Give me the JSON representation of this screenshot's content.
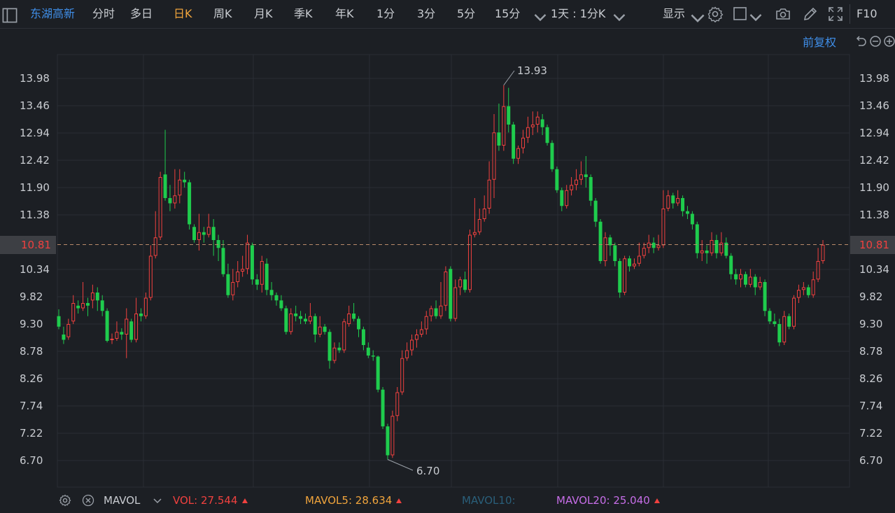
{
  "toolbar": {
    "stock_name": "东湖高新",
    "periods": [
      "分时",
      "多日",
      "日K",
      "周K",
      "月K",
      "季K",
      "年K",
      "1分",
      "3分",
      "5分",
      "15分"
    ],
    "active_period": "日K",
    "more_periods_icon": "chevron-down-icon",
    "interval_label": "1天 : 1分K",
    "display_label": "显示",
    "icons": [
      "settings-icon",
      "square-icon",
      "camera-icon",
      "pen-icon",
      "fullscreen-icon"
    ],
    "f10_label": "F10"
  },
  "price_panel": {
    "adjust_label": "前复权",
    "current_price_label": "10.81",
    "high_label": "13.93",
    "low_label": "6.70",
    "colors": {
      "up": "#f0413f",
      "down": "#1fcc4d",
      "grid": "#2a2e35",
      "background": "#1c1f24"
    }
  },
  "chart_data": {
    "type": "candlestick",
    "y_ticks": [
      "13.98",
      "13.46",
      "12.94",
      "12.42",
      "11.90",
      "11.38",
      "10.81",
      "10.34",
      "9.82",
      "9.30",
      "8.78",
      "8.26",
      "7.74",
      "7.22",
      "6.70"
    ],
    "ylim": [
      6.5,
      14.3
    ],
    "current_price": 10.81,
    "max_marker": 13.93,
    "min_marker": 6.7,
    "candles": [
      [
        9.45,
        9.25,
        9.58,
        9.2
      ],
      [
        9.1,
        9.0,
        9.25,
        8.92
      ],
      [
        9.05,
        9.3,
        9.4,
        9.0
      ],
      [
        9.35,
        9.7,
        9.85,
        9.3
      ],
      [
        9.65,
        9.6,
        9.75,
        9.5
      ],
      [
        9.6,
        9.7,
        10.1,
        9.55
      ],
      [
        9.7,
        9.65,
        9.8,
        9.45
      ],
      [
        9.75,
        9.9,
        10.05,
        9.6
      ],
      [
        9.9,
        9.75,
        10.0,
        9.55
      ],
      [
        9.75,
        9.55,
        9.85,
        9.45
      ],
      [
        9.55,
        8.98,
        9.6,
        8.95
      ],
      [
        9.0,
        9.02,
        9.12,
        8.92
      ],
      [
        9.02,
        9.15,
        9.35,
        8.98
      ],
      [
        9.15,
        9.1,
        9.22,
        9.0
      ],
      [
        9.1,
        9.4,
        9.6,
        8.65
      ],
      [
        9.35,
        9.0,
        9.4,
        8.95
      ],
      [
        9.0,
        9.5,
        9.8,
        8.95
      ],
      [
        9.5,
        9.45,
        9.6,
        9.35
      ],
      [
        9.45,
        9.8,
        9.9,
        9.4
      ],
      [
        9.8,
        10.6,
        10.8,
        9.75
      ],
      [
        10.6,
        10.95,
        11.45,
        10.55
      ],
      [
        10.95,
        12.1,
        12.2,
        10.9
      ],
      [
        12.15,
        11.7,
        13.0,
        11.65
      ],
      [
        11.7,
        11.6,
        11.95,
        11.45
      ],
      [
        11.6,
        11.75,
        12.25,
        11.5
      ],
      [
        11.75,
        12.05,
        12.25,
        11.6
      ],
      [
        12.05,
        12.0,
        12.2,
        11.9
      ],
      [
        12.0,
        11.2,
        12.05,
        11.1
      ],
      [
        11.15,
        10.9,
        11.2,
        10.85
      ],
      [
        10.9,
        11.05,
        11.4,
        10.7
      ],
      [
        11.05,
        11.0,
        11.15,
        10.85
      ],
      [
        11.0,
        11.15,
        11.4,
        10.95
      ],
      [
        11.15,
        10.9,
        11.3,
        10.6
      ],
      [
        10.9,
        10.75,
        11.0,
        10.5
      ],
      [
        10.75,
        10.25,
        10.9,
        10.2
      ],
      [
        10.25,
        9.85,
        10.45,
        9.8
      ],
      [
        9.85,
        10.1,
        10.35,
        9.75
      ],
      [
        10.1,
        10.3,
        10.5,
        10.0
      ],
      [
        10.3,
        10.35,
        10.6,
        10.2
      ],
      [
        10.35,
        10.85,
        11.0,
        10.25
      ],
      [
        10.8,
        10.15,
        10.85,
        10.05
      ],
      [
        10.15,
        10.05,
        10.25,
        9.95
      ],
      [
        10.05,
        10.5,
        10.6,
        9.9
      ],
      [
        10.45,
        9.95,
        10.55,
        9.85
      ],
      [
        9.95,
        9.85,
        10.1,
        9.75
      ],
      [
        9.85,
        9.75,
        9.9,
        9.65
      ],
      [
        9.75,
        9.6,
        9.85,
        9.55
      ],
      [
        9.6,
        9.15,
        9.65,
        9.1
      ],
      [
        9.15,
        9.5,
        9.6,
        9.1
      ],
      [
        9.5,
        9.45,
        9.65,
        9.35
      ],
      [
        9.45,
        9.4,
        9.55,
        9.3
      ],
      [
        9.4,
        9.35,
        9.5,
        9.3
      ],
      [
        9.35,
        9.45,
        9.7,
        9.3
      ],
      [
        9.45,
        9.1,
        9.5,
        8.95
      ],
      [
        9.1,
        9.25,
        9.45,
        9.05
      ],
      [
        9.25,
        9.15,
        9.3,
        9.1
      ],
      [
        9.15,
        8.6,
        9.2,
        8.45
      ],
      [
        8.6,
        8.85,
        8.95,
        8.55
      ],
      [
        8.85,
        8.8,
        8.95,
        8.75
      ],
      [
        8.8,
        9.35,
        9.4,
        8.75
      ],
      [
        9.3,
        9.5,
        9.65,
        9.25
      ],
      [
        9.5,
        9.4,
        9.7,
        9.35
      ],
      [
        9.4,
        9.2,
        9.45,
        9.05
      ],
      [
        9.2,
        8.9,
        9.25,
        8.8
      ],
      [
        8.85,
        8.7,
        8.95,
        8.65
      ],
      [
        8.7,
        8.68,
        8.8,
        8.6
      ],
      [
        8.68,
        8.05,
        8.7,
        8.0
      ],
      [
        8.05,
        7.35,
        8.1,
        7.3
      ],
      [
        7.35,
        6.8,
        7.4,
        6.72
      ],
      [
        6.8,
        7.55,
        7.65,
        6.75
      ],
      [
        7.55,
        8.0,
        8.1,
        7.45
      ],
      [
        8.0,
        8.65,
        8.8,
        7.95
      ],
      [
        8.65,
        8.8,
        8.95,
        8.6
      ],
      [
        8.8,
        9.0,
        9.1,
        8.7
      ],
      [
        9.0,
        9.1,
        9.2,
        8.85
      ],
      [
        9.1,
        9.2,
        9.35,
        9.05
      ],
      [
        9.2,
        9.45,
        9.55,
        9.1
      ],
      [
        9.45,
        9.6,
        9.65,
        9.35
      ],
      [
        9.6,
        9.45,
        9.75,
        9.4
      ],
      [
        9.45,
        9.65,
        10.1,
        9.4
      ],
      [
        9.65,
        10.3,
        10.4,
        9.55
      ],
      [
        10.35,
        9.4,
        10.4,
        9.35
      ],
      [
        9.4,
        10.0,
        10.15,
        9.35
      ],
      [
        10.0,
        10.15,
        10.2,
        9.85
      ],
      [
        10.15,
        9.95,
        10.3,
        9.9
      ],
      [
        9.95,
        11.0,
        11.1,
        9.9
      ],
      [
        11.0,
        11.05,
        11.7,
        10.95
      ],
      [
        11.05,
        11.3,
        11.5,
        11.0
      ],
      [
        11.3,
        11.5,
        11.75,
        11.25
      ],
      [
        11.5,
        12.05,
        12.4,
        11.4
      ],
      [
        12.05,
        12.95,
        13.3,
        11.7
      ],
      [
        12.95,
        12.7,
        13.5,
        12.6
      ],
      [
        12.7,
        13.45,
        13.85,
        12.6
      ],
      [
        13.45,
        13.1,
        13.8,
        12.95
      ],
      [
        13.1,
        12.45,
        13.15,
        12.35
      ],
      [
        12.45,
        12.65,
        12.7,
        12.35
      ],
      [
        12.65,
        12.85,
        13.0,
        12.55
      ],
      [
        12.85,
        13.05,
        13.25,
        12.75
      ],
      [
        13.05,
        13.1,
        13.35,
        12.9
      ],
      [
        13.1,
        13.25,
        13.35,
        12.95
      ],
      [
        13.2,
        13.05,
        13.3,
        12.9
      ],
      [
        13.05,
        12.75,
        13.1,
        12.7
      ],
      [
        12.75,
        12.25,
        12.8,
        12.2
      ],
      [
        12.25,
        11.85,
        12.3,
        11.8
      ],
      [
        11.85,
        11.55,
        11.9,
        11.45
      ],
      [
        11.55,
        11.85,
        11.95,
        11.5
      ],
      [
        11.85,
        11.95,
        12.1,
        11.75
      ],
      [
        11.95,
        12.05,
        12.25,
        11.85
      ],
      [
        12.05,
        12.15,
        12.4,
        11.95
      ],
      [
        12.15,
        12.1,
        12.5,
        11.9
      ],
      [
        12.1,
        11.65,
        12.15,
        11.55
      ],
      [
        11.65,
        11.25,
        11.7,
        11.15
      ],
      [
        11.25,
        10.5,
        11.3,
        10.45
      ],
      [
        10.5,
        10.95,
        11.05,
        10.4
      ],
      [
        10.95,
        10.8,
        11.0,
        10.6
      ],
      [
        10.8,
        10.5,
        10.85,
        10.4
      ],
      [
        10.5,
        9.9,
        10.55,
        9.8
      ],
      [
        9.9,
        10.55,
        10.6,
        9.85
      ],
      [
        10.55,
        10.4,
        10.6,
        10.3
      ],
      [
        10.4,
        10.45,
        10.55,
        10.35
      ],
      [
        10.45,
        10.6,
        10.85,
        10.4
      ],
      [
        10.6,
        10.75,
        10.85,
        10.55
      ],
      [
        10.75,
        10.85,
        11.0,
        10.65
      ],
      [
        10.85,
        10.75,
        10.95,
        10.65
      ],
      [
        10.75,
        10.8,
        11.0,
        10.7
      ],
      [
        10.8,
        11.5,
        11.85,
        10.75
      ],
      [
        11.5,
        11.75,
        11.85,
        11.45
      ],
      [
        11.75,
        11.6,
        11.8,
        11.5
      ],
      [
        11.6,
        11.7,
        11.85,
        11.55
      ],
      [
        11.7,
        11.45,
        11.75,
        11.35
      ],
      [
        11.45,
        11.4,
        11.55,
        11.3
      ],
      [
        11.4,
        11.2,
        11.45,
        11.1
      ],
      [
        11.2,
        10.65,
        11.25,
        10.55
      ],
      [
        10.65,
        10.7,
        10.9,
        10.5
      ],
      [
        10.7,
        10.65,
        10.8,
        10.45
      ],
      [
        10.65,
        10.9,
        11.05,
        10.6
      ],
      [
        10.9,
        10.65,
        11.0,
        10.55
      ],
      [
        10.65,
        10.85,
        11.05,
        10.6
      ],
      [
        10.85,
        10.6,
        10.95,
        10.55
      ],
      [
        10.6,
        10.25,
        10.65,
        10.15
      ],
      [
        10.25,
        10.15,
        10.35,
        10.05
      ],
      [
        10.15,
        10.25,
        10.35,
        10.0
      ],
      [
        10.25,
        10.05,
        10.3,
        10.0
      ],
      [
        10.05,
        10.2,
        10.35,
        10.0
      ],
      [
        10.2,
        10.0,
        10.25,
        9.85
      ],
      [
        10.0,
        10.1,
        10.2,
        9.95
      ],
      [
        10.1,
        9.55,
        10.15,
        9.45
      ],
      [
        9.55,
        9.35,
        9.6,
        9.3
      ],
      [
        9.35,
        9.3,
        9.5,
        9.25
      ],
      [
        9.3,
        8.95,
        9.4,
        8.88
      ],
      [
        8.95,
        9.45,
        9.55,
        8.9
      ],
      [
        9.45,
        9.25,
        9.5,
        9.2
      ],
      [
        9.25,
        9.8,
        9.85,
        9.2
      ],
      [
        9.8,
        9.95,
        10.05,
        9.7
      ],
      [
        9.95,
        10.0,
        10.1,
        9.85
      ],
      [
        10.0,
        9.85,
        10.05,
        9.8
      ],
      [
        9.85,
        10.15,
        10.3,
        9.8
      ],
      [
        10.15,
        10.5,
        10.75,
        10.1
      ],
      [
        10.5,
        10.81,
        10.9,
        10.45
      ]
    ]
  },
  "indicator": {
    "settings_icon": "gear-icon",
    "close_icon": "close-icon",
    "name": "MAVOL",
    "vol_label": "VOL:",
    "vol_value": "27.544",
    "mavol5_label": "MAVOL5:",
    "mavol5_value": "28.634",
    "mavol10_label": "MAVOL10:",
    "mavol20_label": "MAVOL20:",
    "mavol20_value": "25.040",
    "colors": {
      "vol": "#f0413f",
      "mavol5": "#f0a43c",
      "mavol10": "#2a5f7a",
      "mavol20": "#c76ee8"
    }
  }
}
